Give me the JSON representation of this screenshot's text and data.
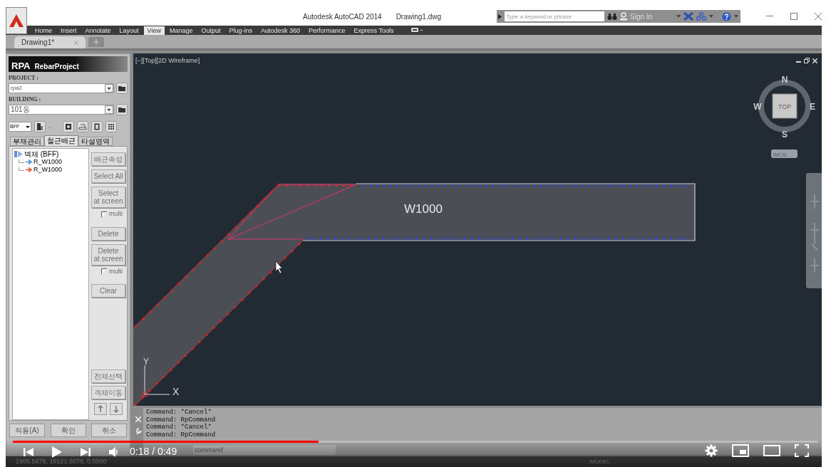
{
  "app_window": {
    "title": "Autodesk AutoCAD 2014",
    "file_name": "Drawing1.dwg",
    "search_placeholder": "Type a keyword or phrase",
    "sign_in": "Sign In"
  },
  "ribbon_tabs": [
    {
      "label": "Home",
      "selected": false
    },
    {
      "label": "Insert",
      "selected": false
    },
    {
      "label": "Annotate",
      "selected": false
    },
    {
      "label": "Layout",
      "selected": false
    },
    {
      "label": "View",
      "selected": true
    },
    {
      "label": "Manage",
      "selected": false
    },
    {
      "label": "Output",
      "selected": false
    },
    {
      "label": "Plug-ins",
      "selected": false
    },
    {
      "label": "Autodesk 360",
      "selected": false
    },
    {
      "label": "Performance",
      "selected": false
    },
    {
      "label": "Express Tools",
      "selected": false
    }
  ],
  "document_tabs": [
    {
      "label": "Drawing1*",
      "selected": true
    }
  ],
  "plugin_panel": {
    "brand": "RPA",
    "title": "RebarProject",
    "project_label": "PROJECT :",
    "project": "rpa2",
    "building_label": "BUILDING :",
    "building": "101동",
    "floor": "BFF",
    "floor_suffix": "..",
    "tabs": [
      {
        "label": "부재관리",
        "selected": false
      },
      {
        "label": "철근배근",
        "selected": true
      },
      {
        "label": "타설영역",
        "selected": false
      }
    ],
    "tree": [
      {
        "label": "벽체 (BFF)",
        "expanded": true,
        "children": [
          {
            "label": "R_W1000",
            "color": "#3b8fe0"
          },
          {
            "label": "R_W1000",
            "color": "#e8502a"
          }
        ]
      }
    ],
    "side_controls": [
      {
        "kind": "button",
        "label": "배근속성",
        "disabled": true
      },
      {
        "kind": "button",
        "label": "Select All",
        "disabled": true
      },
      {
        "kind": "button",
        "label": "Select\nat screen",
        "disabled": true
      },
      {
        "kind": "checkbox",
        "label": "multi",
        "checked": false
      },
      {
        "kind": "button",
        "label": "Delete",
        "disabled": true
      },
      {
        "kind": "button",
        "label": "Delete\nat screen",
        "disabled": true
      },
      {
        "kind": "checkbox",
        "label": "multi",
        "checked": false
      },
      {
        "kind": "button",
        "label": "Clear",
        "disabled": true
      }
    ],
    "lower_buttons": [
      {
        "label": "전체선택",
        "disabled": true
      },
      {
        "label": "객체이동",
        "disabled": true
      }
    ],
    "footer_buttons": [
      {
        "label": "적용(A)"
      },
      {
        "label": "확인"
      },
      {
        "label": "취소"
      }
    ]
  },
  "viewport": {
    "label": "[−][Top][2D Wireframe]",
    "wall_label": "W1000",
    "axis_x": "X",
    "axis_y": "Y",
    "viewcube": {
      "north": "N",
      "east": "E",
      "south": "S",
      "west": "W",
      "face": "TOP",
      "ucs": "WCS"
    }
  },
  "command_history": [
    "Command: *Cancel*",
    "Command: RpCommand",
    "Command: *Cancel*",
    "Command: RpCommand"
  ],
  "command_input": {
    "placeholder": "command"
  },
  "status_bar": {
    "coordinates": "1906.5678, 19121.6076, 0.0000",
    "space": "MODEL"
  },
  "video_player": {
    "level": 0.38,
    "time": "0:18 / 0:49"
  }
}
